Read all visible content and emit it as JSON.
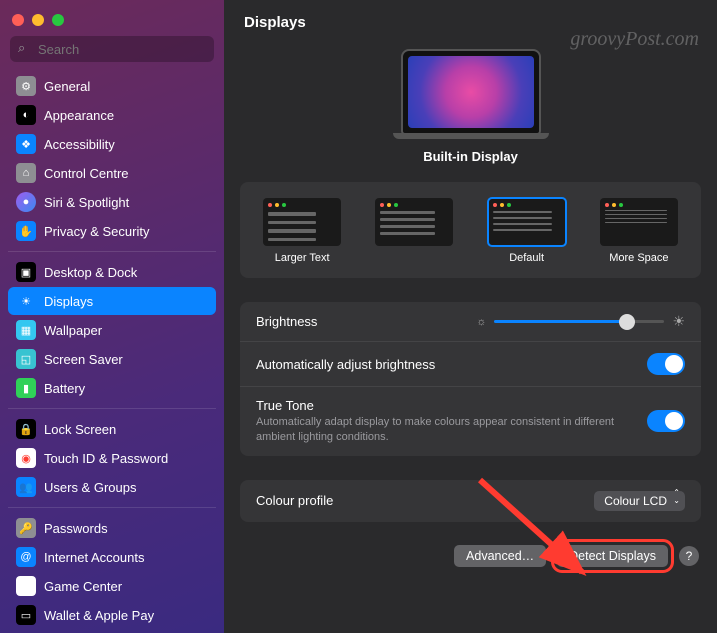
{
  "watermark": "groovyPost.com",
  "search": {
    "placeholder": "Search"
  },
  "sidebar": {
    "groups": [
      [
        {
          "label": "General",
          "icon": "gear"
        },
        {
          "label": "Appearance",
          "icon": "appear"
        },
        {
          "label": "Accessibility",
          "icon": "acc"
        },
        {
          "label": "Control Centre",
          "icon": "cc"
        },
        {
          "label": "Siri & Spotlight",
          "icon": "siri"
        },
        {
          "label": "Privacy & Security",
          "icon": "priv"
        }
      ],
      [
        {
          "label": "Desktop & Dock",
          "icon": "desk"
        },
        {
          "label": "Displays",
          "icon": "disp",
          "selected": true
        },
        {
          "label": "Wallpaper",
          "icon": "wall"
        },
        {
          "label": "Screen Saver",
          "icon": "ss"
        },
        {
          "label": "Battery",
          "icon": "bat"
        }
      ],
      [
        {
          "label": "Lock Screen",
          "icon": "lock"
        },
        {
          "label": "Touch ID & Password",
          "icon": "touch"
        },
        {
          "label": "Users & Groups",
          "icon": "users"
        }
      ],
      [
        {
          "label": "Passwords",
          "icon": "pass"
        },
        {
          "label": "Internet Accounts",
          "icon": "inet"
        },
        {
          "label": "Game Center",
          "icon": "game"
        },
        {
          "label": "Wallet & Apple Pay",
          "icon": "wallet"
        }
      ]
    ]
  },
  "page": {
    "title": "Displays",
    "display_name": "Built-in Display",
    "scale_options": [
      {
        "label": "Larger Text",
        "size": "lg"
      },
      {
        "label": "",
        "size": "md"
      },
      {
        "label": "Default",
        "size": "df",
        "selected": true
      },
      {
        "label": "More Space",
        "size": "sp"
      }
    ],
    "brightness_label": "Brightness",
    "brightness_value": 78,
    "auto_brightness": {
      "label": "Automatically adjust brightness",
      "on": true
    },
    "true_tone": {
      "label": "True Tone",
      "sub": "Automatically adapt display to make colours appear consistent in different ambient lighting conditions.",
      "on": true
    },
    "colour_profile": {
      "label": "Colour profile",
      "value": "Colour LCD"
    },
    "advanced_label": "Advanced…",
    "detect_label": "Detect Displays",
    "help_label": "?"
  },
  "icon_glyphs": {
    "gear": "⚙",
    "appear": "◐",
    "acc": "❖",
    "cc": "⌂",
    "siri": "●",
    "priv": "✋",
    "desk": "▣",
    "disp": "☀",
    "wall": "▦",
    "ss": "◱",
    "bat": "▮",
    "lock": "🔒",
    "touch": "◉",
    "users": "👥",
    "pass": "🔑",
    "inet": "@",
    "game": "◆",
    "wallet": "▭"
  }
}
